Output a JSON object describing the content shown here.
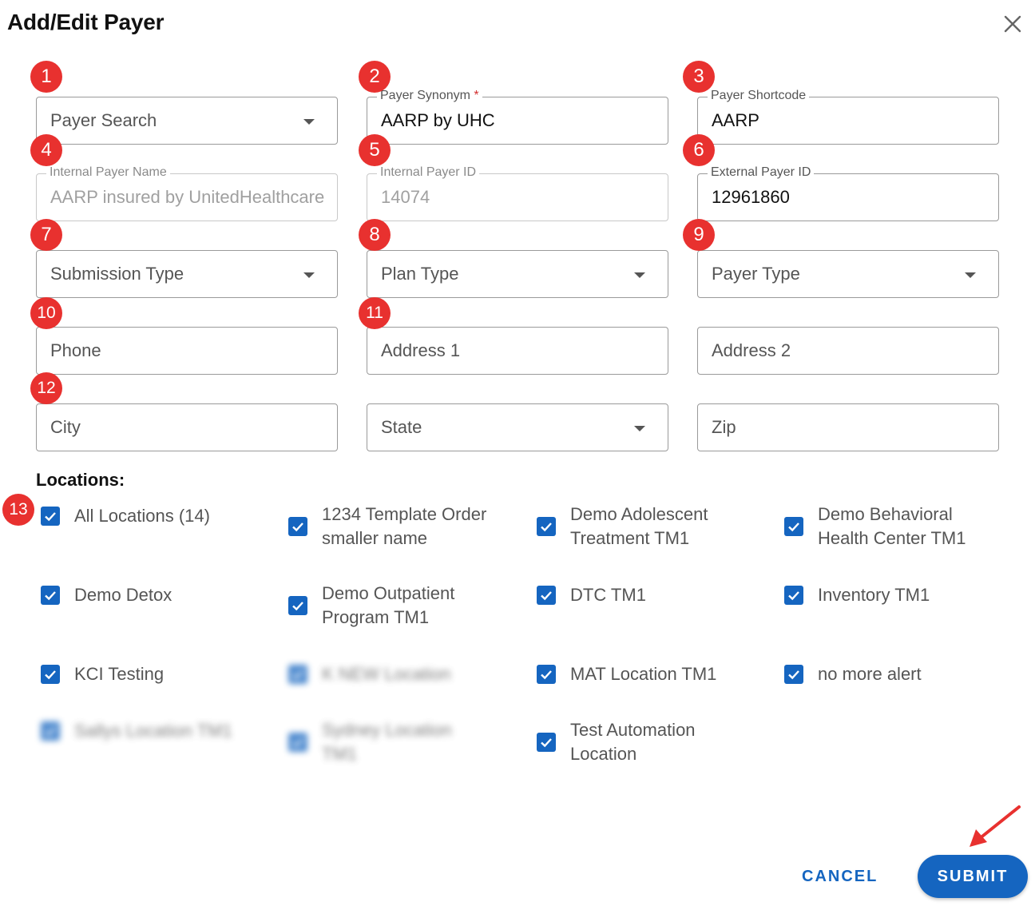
{
  "dialog": {
    "title": "Add/Edit Payer"
  },
  "badges": [
    "1",
    "2",
    "3",
    "4",
    "5",
    "6",
    "7",
    "8",
    "9",
    "10",
    "11",
    "12",
    "13"
  ],
  "fields": {
    "payer_search": {
      "placeholder": "Payer Search"
    },
    "payer_synonym": {
      "label": "Payer Synonym",
      "required_mark": "*",
      "value": "AARP by UHC"
    },
    "payer_shortcode": {
      "label": "Payer Shortcode",
      "value": "AARP"
    },
    "internal_payer_name": {
      "label": "Internal Payer Name",
      "value": "AARP  insured by UnitedHealthcare"
    },
    "internal_payer_id": {
      "label": "Internal Payer ID",
      "value": "14074"
    },
    "external_payer_id": {
      "label": "External Payer ID",
      "value": "12961860"
    },
    "submission_type": {
      "placeholder": "Submission Type"
    },
    "plan_type": {
      "placeholder": "Plan Type"
    },
    "payer_type": {
      "placeholder": "Payer Type"
    },
    "phone": {
      "placeholder": "Phone"
    },
    "address1": {
      "placeholder": "Address 1"
    },
    "address2": {
      "placeholder": "Address 2"
    },
    "city": {
      "placeholder": "City"
    },
    "state": {
      "placeholder": "State"
    },
    "zip": {
      "placeholder": "Zip"
    }
  },
  "locations": {
    "title": "Locations:",
    "items": [
      {
        "line1": "All Locations (14)",
        "line2": "",
        "checked": true
      },
      {
        "line1": "1234 Template Order",
        "line2": "smaller name",
        "checked": true
      },
      {
        "line1": "Demo Adolescent",
        "line2": "Treatment TM1",
        "checked": true
      },
      {
        "line1": "Demo Behavioral",
        "line2": "Health Center TM1",
        "checked": true
      },
      {
        "line1": "Demo Detox",
        "line2": "",
        "checked": true
      },
      {
        "line1": "Demo Outpatient",
        "line2": "Program TM1",
        "checked": true
      },
      {
        "line1": "DTC TM1",
        "line2": "",
        "checked": true
      },
      {
        "line1": "Inventory TM1",
        "line2": "",
        "checked": true
      },
      {
        "line1": "KCI Testing",
        "line2": "",
        "checked": true
      },
      {
        "line1": "K NEW Location",
        "line2": "",
        "checked": true
      },
      {
        "line1": "MAT Location TM1",
        "line2": "",
        "checked": true
      },
      {
        "line1": "no more alert",
        "line2": "",
        "checked": true
      },
      {
        "line1": "Sallys Location TM1",
        "line2": "",
        "checked": true
      },
      {
        "line1": "Sydney Location",
        "line2": "TM1",
        "checked": true
      },
      {
        "line1": "Test Automation",
        "line2": "Location",
        "checked": true
      }
    ]
  },
  "actions": {
    "cancel": "CANCEL",
    "submit": "SUBMIT"
  },
  "colors": {
    "primary": "#1565c0",
    "badge": "#e8312f",
    "arrow": "#e8312f"
  }
}
